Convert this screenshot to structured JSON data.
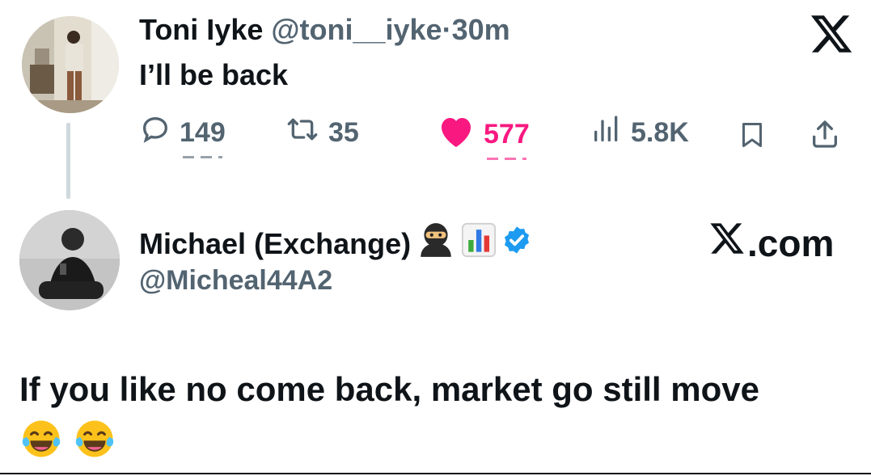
{
  "tweet1": {
    "author_name": "Toni Iyke",
    "handle": "@toni__iyke",
    "separator": "·",
    "time": "30m",
    "text": "I’ll be back",
    "replies": "149",
    "retweets": "35",
    "likes": "577",
    "views": "5.8K",
    "liked": true,
    "icons": [
      "x-logo-icon",
      "reply-icon",
      "retweet-icon",
      "heart-icon",
      "views-icon",
      "bookmark-icon",
      "share-icon"
    ]
  },
  "tweet2": {
    "author_name": "Michael (Exchange)",
    "handle": "@Micheal44A2",
    "site_label": ".com",
    "text": "If you like no come back, market go still move",
    "verified": true,
    "name_emojis": [
      "ninja-icon",
      "bar-chart-icon"
    ],
    "trailing_emojis": [
      "tears-of-joy-icon",
      "tears-of-joy-icon"
    ]
  },
  "colors": {
    "text": "#0f1419",
    "muted": "#536471",
    "like": "#f91880",
    "verified": "#1d9bf0",
    "thread_line": "#cfd9de"
  }
}
